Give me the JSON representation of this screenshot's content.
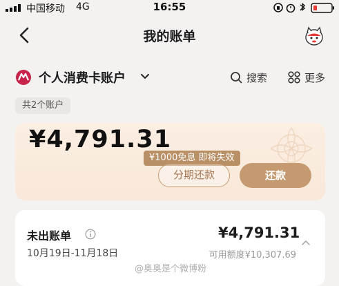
{
  "status_bar": {
    "carrier": "中国移动",
    "network": "4G",
    "time": "16:55"
  },
  "nav": {
    "title": "我的账单"
  },
  "account": {
    "name": "个人消费卡账户",
    "search_label": "搜索",
    "more_label": "更多",
    "count_label": "共2个账户"
  },
  "balance_card": {
    "amount": "¥4,791.31",
    "promo_tag": "¥1000免息 即将失效",
    "installment_label": "分期还款",
    "repay_label": "还款"
  },
  "bill": {
    "title": "未出账单",
    "period": "10月19日-11月18日",
    "amount": "¥4,791.31",
    "available_limit": "可用额度¥10,307.69"
  },
  "watermark": "@奥奥是个微博粉"
}
